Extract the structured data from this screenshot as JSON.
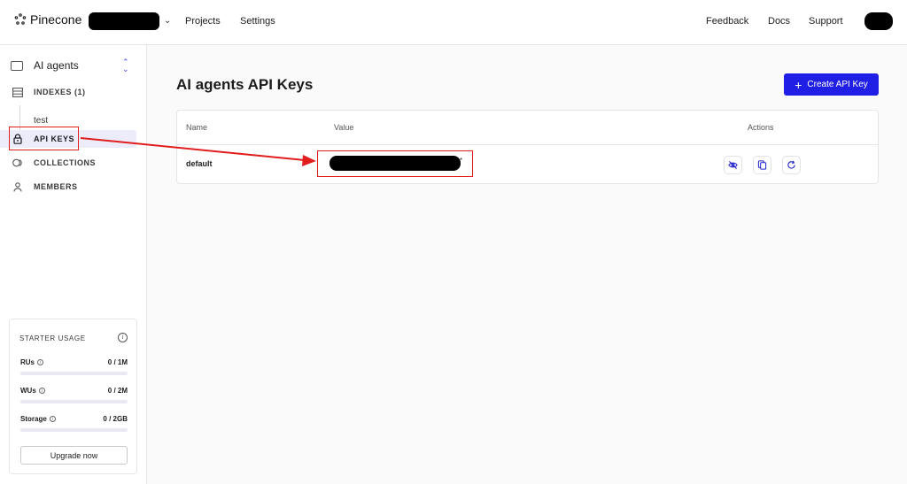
{
  "topnav": {
    "logo_text": "Pinecone",
    "links": {
      "projects": "Projects",
      "settings": "Settings",
      "feedback": "Feedback",
      "docs": "Docs",
      "support": "Support"
    }
  },
  "sidebar": {
    "project_name": "AI agents",
    "items": [
      {
        "label": "INDEXES (1)",
        "icon": "indexes-icon"
      },
      {
        "label": "API KEYS",
        "icon": "lock-icon",
        "active": true
      },
      {
        "label": "COLLECTIONS",
        "icon": "collections-icon"
      },
      {
        "label": "MEMBERS",
        "icon": "person-icon"
      }
    ],
    "indexes": [
      "test"
    ]
  },
  "usage": {
    "title": "STARTER USAGE",
    "rows": [
      {
        "label": "RUs",
        "value": "0 / 1M",
        "fraction": 0
      },
      {
        "label": "WUs",
        "value": "0 / 2M",
        "fraction": 0
      },
      {
        "label": "Storage",
        "value": "0 / 2GB",
        "fraction": 0
      }
    ],
    "upgrade_label": "Upgrade now"
  },
  "main": {
    "title": "AI agents API Keys",
    "create_label": "Create API Key",
    "table": {
      "headers": {
        "name": "Name",
        "value": "Value",
        "actions": "Actions"
      },
      "rows": [
        {
          "name": "default",
          "value_suffix": "*"
        }
      ]
    },
    "action_icons": [
      "eye-off-icon",
      "copy-icon",
      "refresh-icon"
    ]
  },
  "colors": {
    "accent": "#1f1fe6",
    "annotation": "#e01e1e",
    "active_bg": "#ececfb"
  }
}
